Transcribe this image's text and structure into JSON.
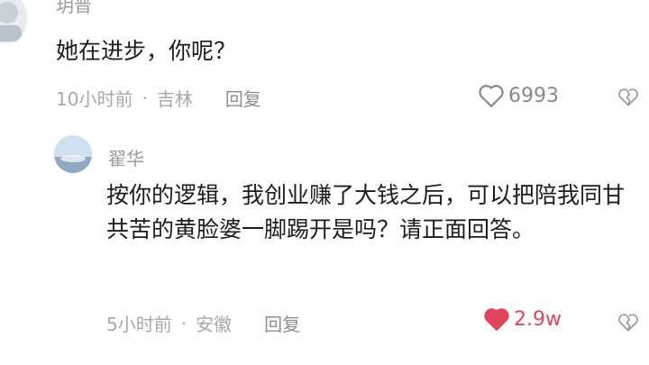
{
  "comments": [
    {
      "username": "玥晋",
      "text": "她在进步，你呢？",
      "time": "10小时前",
      "location": "吉林",
      "reply_label": "回复",
      "likes": "6993",
      "liked": false
    },
    {
      "username": "翟华",
      "text": "按你的逻辑，我创业赚了大钱之后，可以把陪我同甘共苦的黄脸婆一脚踢开是吗？请正面回答。",
      "time": "5小时前",
      "location": "安徽",
      "reply_label": "回复",
      "likes": "2.9w",
      "liked": true
    }
  ],
  "colors": {
    "liked_heart": "#e0455e",
    "meta_text": "#a8a8a8"
  },
  "icons": [
    "heart-icon",
    "dislike-icon"
  ]
}
